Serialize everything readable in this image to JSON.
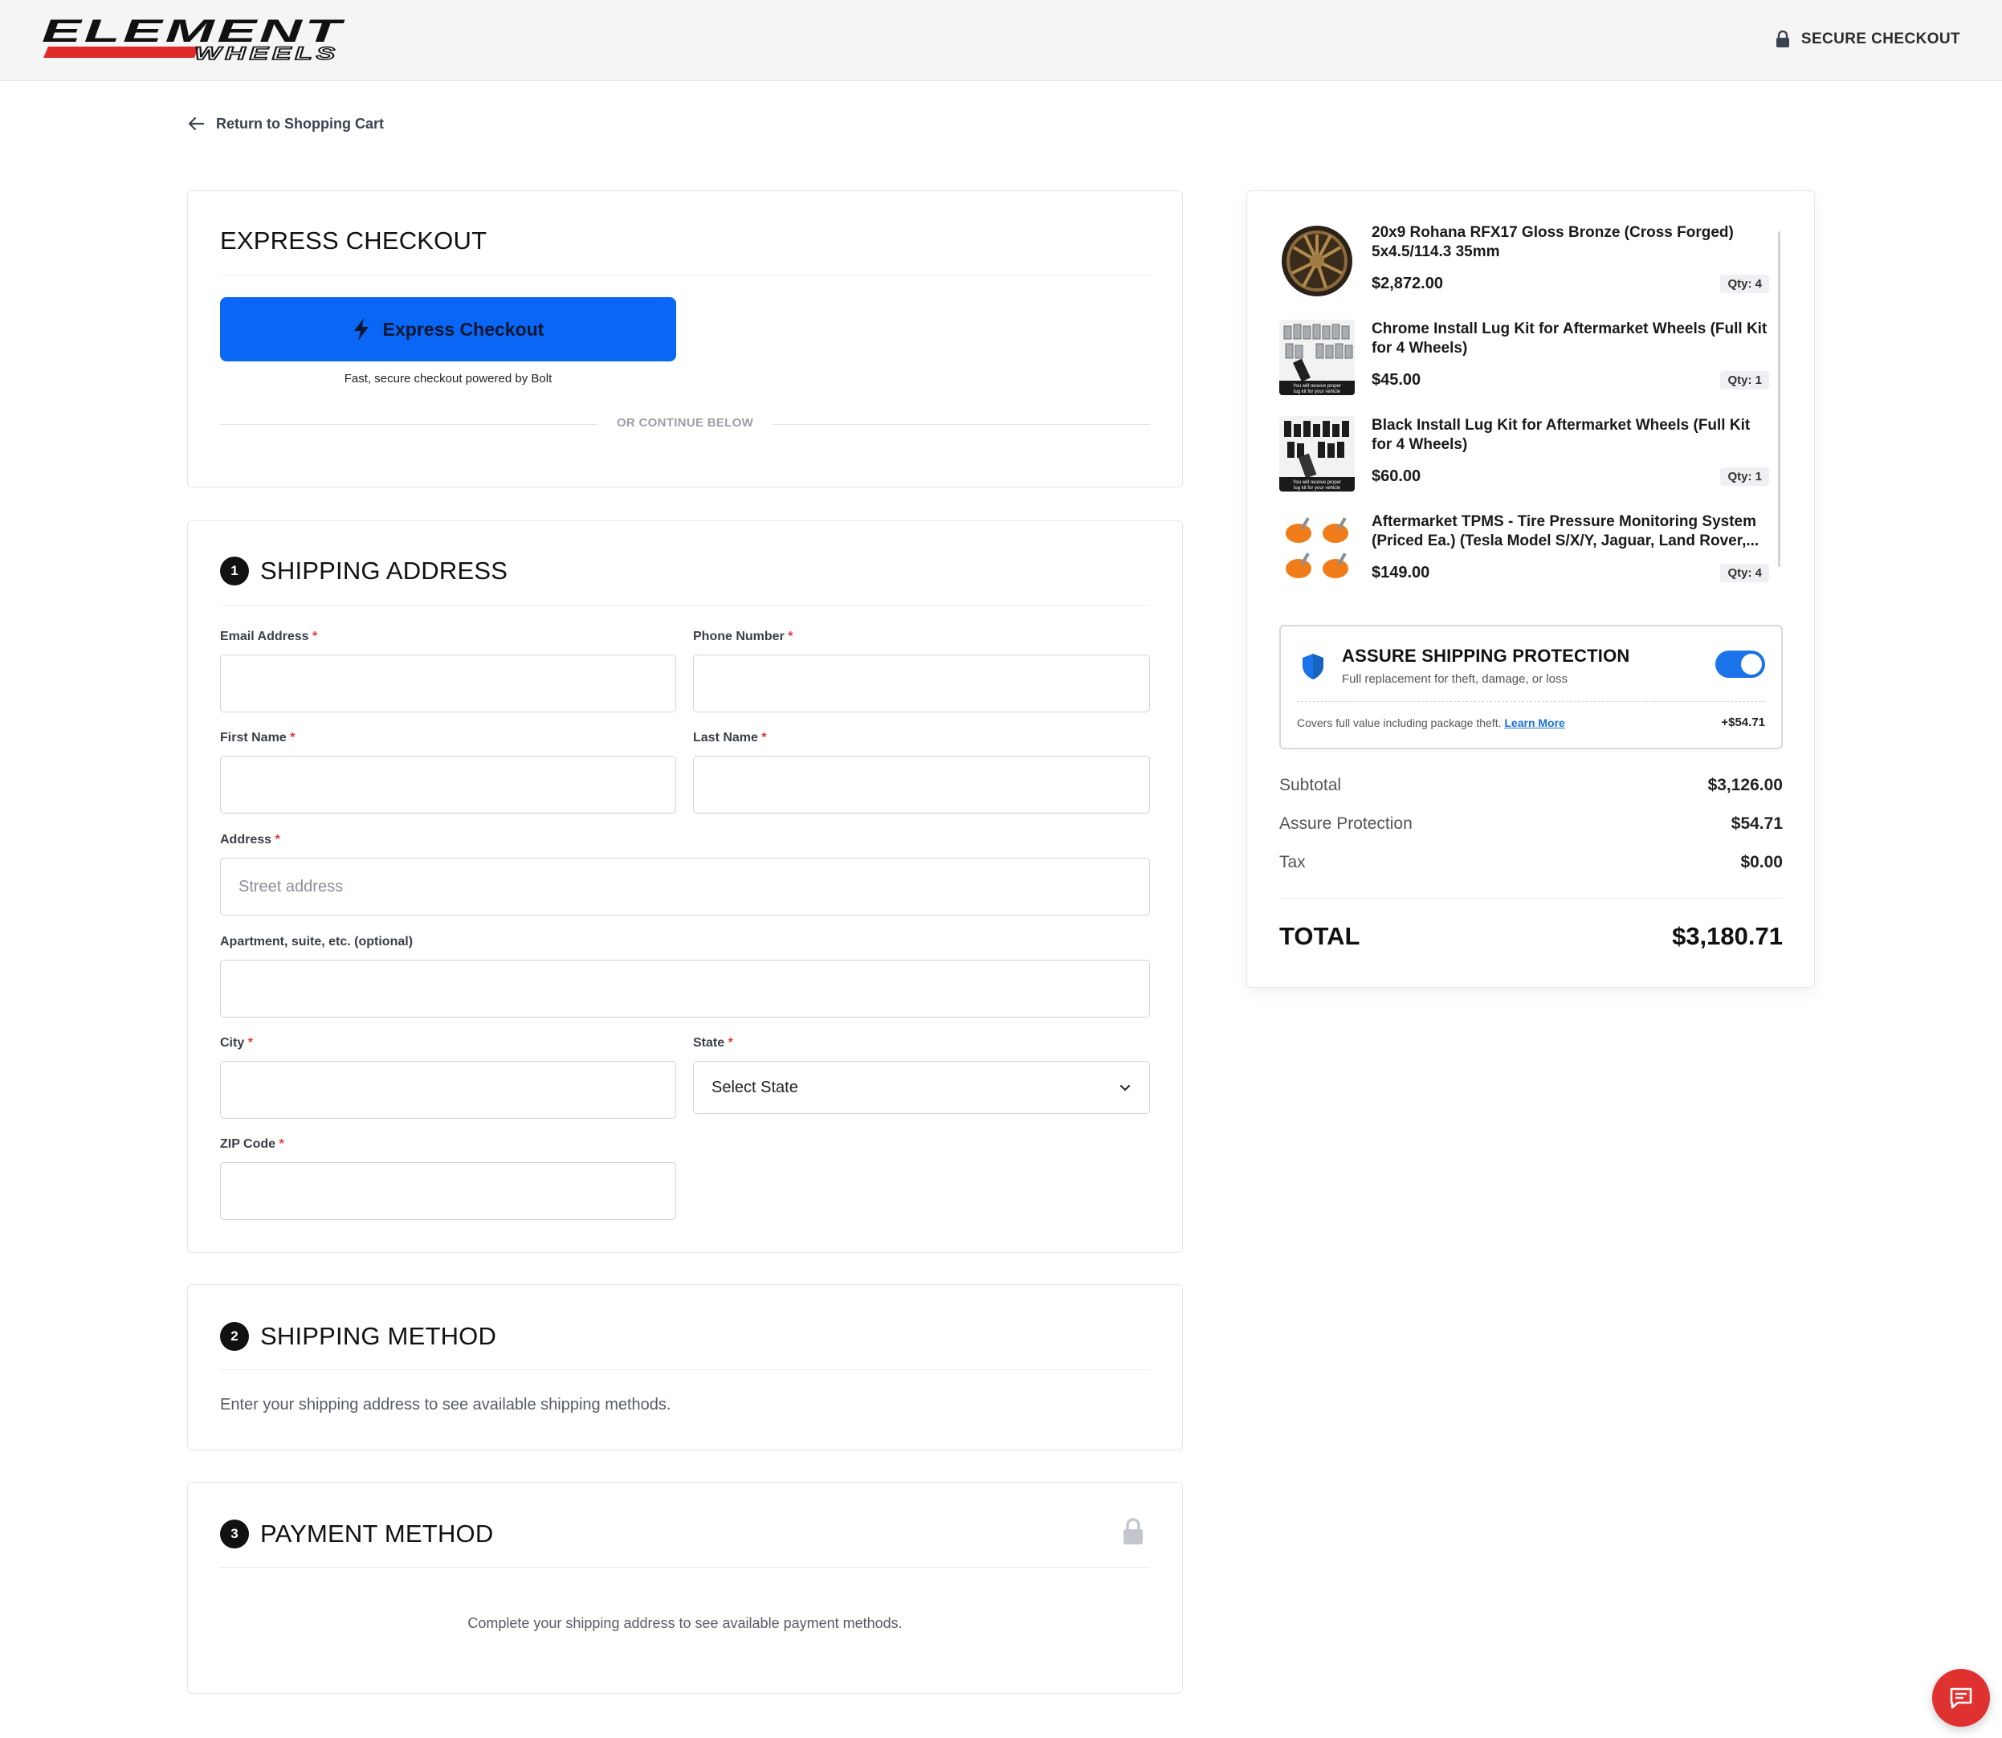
{
  "header": {
    "brand_top": "ELEMENT",
    "brand_bottom": "WHEELS",
    "secure_label": "SECURE CHECKOUT"
  },
  "nav": {
    "back_label": "Return to Shopping Cart"
  },
  "express": {
    "title": "EXPRESS CHECKOUT",
    "button_label": "Express Checkout",
    "subtext": "Fast, secure checkout powered by Bolt",
    "divider_text": "OR CONTINUE BELOW"
  },
  "shipping_address": {
    "step": "1",
    "title": "SHIPPING ADDRESS",
    "fields": {
      "email": {
        "label": "Email Address",
        "value": ""
      },
      "phone": {
        "label": "Phone Number",
        "value": ""
      },
      "first_name": {
        "label": "First Name",
        "value": ""
      },
      "last_name": {
        "label": "Last Name",
        "value": ""
      },
      "address": {
        "label": "Address",
        "placeholder": "Street address"
      },
      "apartment": {
        "label": "Apartment, suite, etc. (optional)",
        "value": ""
      },
      "city": {
        "label": "City",
        "value": ""
      },
      "state": {
        "label": "State",
        "selected": "Select State"
      },
      "zip": {
        "label": "ZIP Code",
        "value": ""
      }
    },
    "required_mark": "*"
  },
  "shipping_method": {
    "step": "2",
    "title": "SHIPPING METHOD",
    "message": "Enter your shipping address to see available shipping methods."
  },
  "payment_method": {
    "step": "3",
    "title": "PAYMENT METHOD",
    "message": "Complete your shipping address to see available payment methods."
  },
  "summary": {
    "items": [
      {
        "name": "20x9 Rohana RFX17 Gloss Bronze (Cross Forged) 5x4.5/114.3 35mm",
        "price": "$2,872.00",
        "qty": "Qty: 4",
        "thumb": "bronze-wheel"
      },
      {
        "name": "Chrome Install Lug Kit for Aftermarket Wheels (Full Kit for 4 Wheels)",
        "price": "$45.00",
        "qty": "Qty: 1",
        "thumb": "chrome-lug-kit"
      },
      {
        "name": "Black Install Lug Kit for Aftermarket Wheels (Full Kit for 4 Wheels)",
        "price": "$60.00",
        "qty": "Qty: 1",
        "thumb": "black-lug-kit"
      },
      {
        "name": "Aftermarket TPMS - Tire Pressure Monitoring System (Priced Ea.) (Tesla Model S/X/Y, Jaguar, Land Rover,...",
        "price": "$149.00",
        "qty": "Qty: 4",
        "thumb": "tpms-sensors"
      }
    ],
    "protection": {
      "title": "ASSURE SHIPPING PROTECTION",
      "subtitle": "Full replacement for theft, damage, or loss",
      "cover_text": "Covers full value including package theft.",
      "learn_more": "Learn More",
      "price": "+$54.71",
      "enabled": true
    },
    "rows": [
      {
        "label": "Subtotal",
        "value": "$3,126.00"
      },
      {
        "label": "Assure Protection",
        "value": "$54.71"
      },
      {
        "label": "Tax",
        "value": "$0.00"
      }
    ],
    "total_label": "TOTAL",
    "total_value": "$3,180.71"
  },
  "colors": {
    "accent_blue": "#0a66f5",
    "toggle_blue": "#1a73e8",
    "brand_red": "#e03131",
    "required_red": "#e53935"
  }
}
